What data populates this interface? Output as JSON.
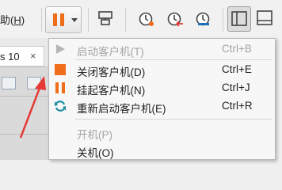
{
  "toolbar": {
    "help_menu_prefix": "助(",
    "help_menu_key": "H",
    "help_menu_suffix": ")",
    "pause_button_color": "#ef6c1a",
    "icons": [
      "pause-icon",
      "chevron-down-icon",
      "send-keys-icon",
      "snapshot-icon",
      "revert-snapshot-icon",
      "manage-snapshots-icon",
      "sidebar-view-icon",
      "console-view-icon"
    ]
  },
  "tab": {
    "label": "s 10",
    "close": "×"
  },
  "menu": {
    "items": [
      {
        "icon": "play-icon",
        "label": "启动客户机(T)",
        "shortcut": "Ctrl+B",
        "enabled": false
      },
      {
        "icon": "stop-icon",
        "label": "关闭客户机(D)",
        "shortcut": "Ctrl+E",
        "enabled": true
      },
      {
        "icon": "pause-icon",
        "label": "挂起客户机(N)",
        "shortcut": "Ctrl+J",
        "enabled": true
      },
      {
        "icon": "restart-icon",
        "label": "重新启动客户机(E)",
        "shortcut": "Ctrl+R",
        "enabled": true
      },
      {
        "icon": "",
        "label": "开机(P)",
        "shortcut": "",
        "enabled": false
      },
      {
        "icon": "",
        "label": "关机(O)",
        "shortcut": "",
        "enabled": true
      }
    ]
  },
  "colors": {
    "accent_orange": "#ef6c1a",
    "restart_teal": "#1e8fa0",
    "annotation_red": "#e53935"
  }
}
